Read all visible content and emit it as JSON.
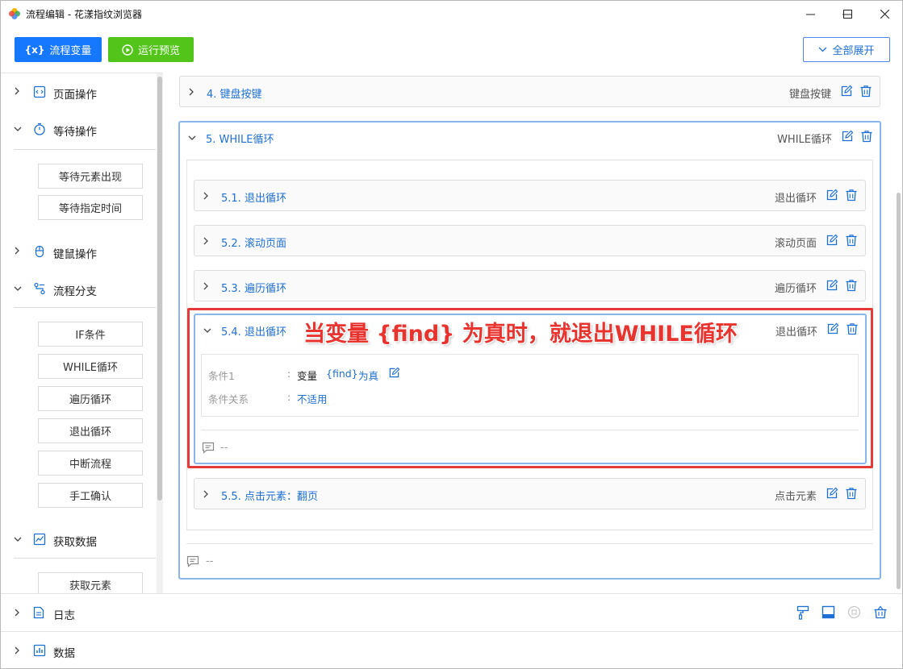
{
  "window": {
    "title": "流程编辑 - 花漾指纹浏览器"
  },
  "toolbar": {
    "variables_label": "流程变量",
    "variables_icon_text": "{x}",
    "run_label": "运行预览",
    "expand_label": "全部展开"
  },
  "sidebar": {
    "groups": [
      {
        "label": "页面操作",
        "expanded": false
      },
      {
        "label": "等待操作",
        "expanded": true,
        "items": [
          "等待元素出现",
          "等待指定时间"
        ]
      },
      {
        "label": "键鼠操作",
        "expanded": false
      },
      {
        "label": "流程分支",
        "expanded": true,
        "items": [
          "IF条件",
          "WHILE循环",
          "遍历循环",
          "退出循环",
          "中断流程",
          "手工确认"
        ]
      },
      {
        "label": "获取数据",
        "expanded": true,
        "items": [
          "获取元素"
        ]
      }
    ]
  },
  "steps": {
    "step4": {
      "title": "4. 键盘按键",
      "type": "键盘按键"
    },
    "step5": {
      "title": "5. WHILE循环",
      "type": "WHILE循环",
      "comment": "--"
    },
    "step5_1": {
      "title": "5.1. 退出循环",
      "type": "退出循环"
    },
    "step5_2": {
      "title": "5.2. 滚动页面",
      "type": "滚动页面"
    },
    "step5_3": {
      "title": "5.3. 遍历循环",
      "type": "遍历循环"
    },
    "step5_4": {
      "title": "5.4. 退出循环",
      "type": "退出循环",
      "cond1_label": "条件1",
      "colon": ":",
      "cond1_prefix": "变量",
      "cond1_var": "{find}",
      "cond1_suffix": "为真",
      "relation_label": "条件关系",
      "relation_value": "不适用",
      "comment": "--"
    },
    "step5_5": {
      "title": "5.5. 点击元素：翻页",
      "type": "点击元素"
    }
  },
  "annotation": "当变量 {find} 为真时，就退出WHILE循环",
  "bottom": {
    "log_label": "日志",
    "data_label": "数据"
  },
  "colors": {
    "accent": "#1677ff",
    "run": "#52c41a",
    "link": "#1d6fd6",
    "highlight": "#e53a3a"
  }
}
